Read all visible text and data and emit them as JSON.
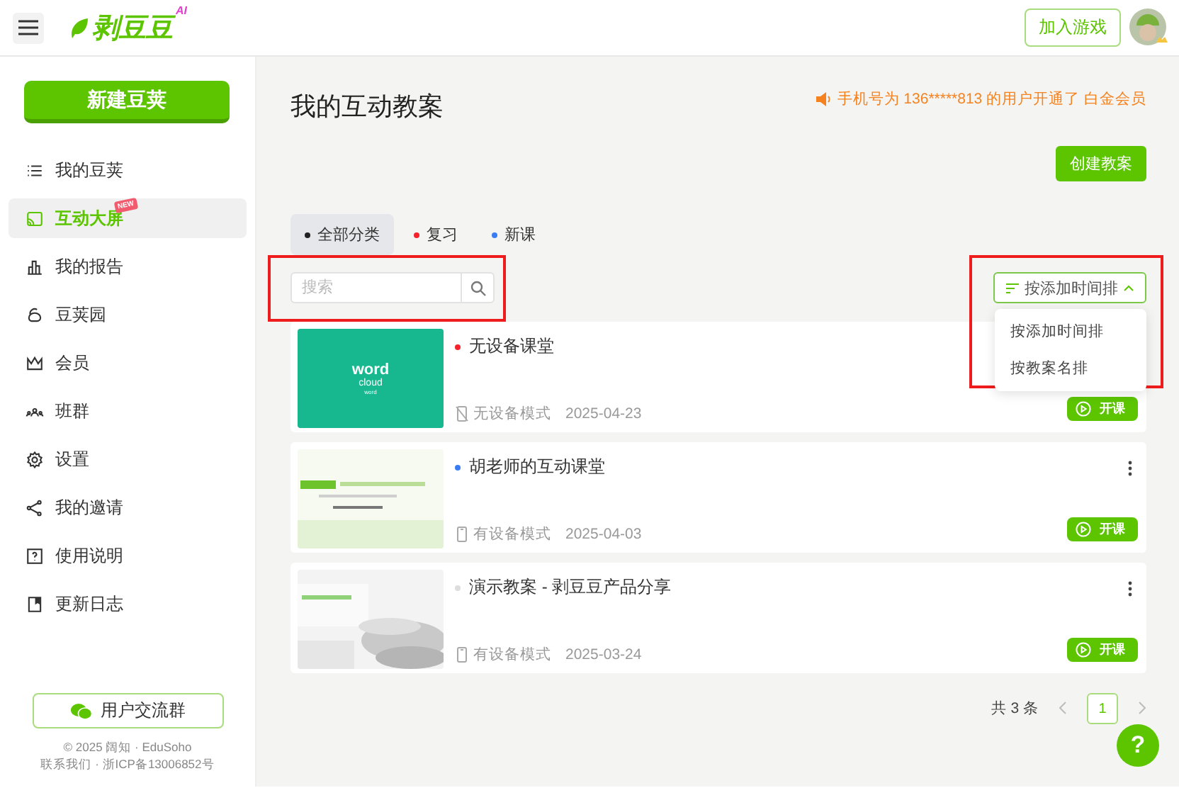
{
  "header": {
    "logo": "剥豆豆",
    "logo_badge": "AI",
    "join_button": "加入游戏"
  },
  "sidebar": {
    "new_button": "新建豆荚",
    "items": [
      {
        "label": "我的豆荚",
        "selected": false
      },
      {
        "label": "互动大屏",
        "selected": true,
        "badge": "NEW"
      },
      {
        "label": "我的报告",
        "selected": false
      },
      {
        "label": "豆荚园",
        "selected": false
      },
      {
        "label": "会员",
        "selected": false
      },
      {
        "label": "班群",
        "selected": false
      },
      {
        "label": "设置",
        "selected": false
      },
      {
        "label": "我的邀请",
        "selected": false
      },
      {
        "label": "使用说明",
        "selected": false
      },
      {
        "label": "更新日志",
        "selected": false
      }
    ],
    "community_button": "用户交流群",
    "footer": [
      "© 2025 阔知 · EduSoho",
      "联系我们 · 浙ICP备13006852号"
    ]
  },
  "main": {
    "title": "我的互动教案",
    "notice": "手机号为 136*****813 的用户开通了 白金会员",
    "create_button": "创建教案",
    "categories": [
      {
        "label": "全部分类",
        "color": "#222222",
        "selected": true
      },
      {
        "label": "复习",
        "color": "#f5222d",
        "selected": false
      },
      {
        "label": "新课",
        "color": "#3b7cf5",
        "selected": false
      }
    ],
    "search": {
      "placeholder": "搜索",
      "highlighted": true
    },
    "sort": {
      "label": "按添加时间排",
      "highlighted": true,
      "expanded": true,
      "options": [
        "按添加时间排",
        "按教案名排"
      ]
    },
    "lessons": [
      {
        "title": "无设备课堂",
        "color": "#f5222d",
        "mode": "无设备模式",
        "kind": "no_device",
        "date": "2025-04-23",
        "start_button": "开课",
        "more_menu": false,
        "thumb": {
          "kind": "slide",
          "texts": [
            "word",
            "cloud",
            "word"
          ]
        }
      },
      {
        "title": "胡老师的互动课堂",
        "color": "#3b7cf5",
        "mode": "有设备模式",
        "kind": "device",
        "date": "2025-04-03",
        "start_button": "开课",
        "more_menu": true
      },
      {
        "title": "演示教案 - 剥豆豆产品分享",
        "color": "#dddddd",
        "mode": "有设备模式",
        "kind": "device",
        "date": "2025-03-24",
        "start_button": "开课",
        "more_menu": true
      }
    ],
    "pagination": {
      "total": "共 3 条",
      "pages": [
        {
          "label": "1",
          "selected": true
        }
      ]
    },
    "help_button": "?"
  }
}
